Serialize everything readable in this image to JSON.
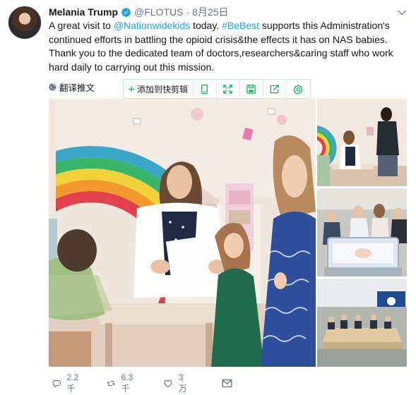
{
  "tweet": {
    "display_name": "Melania Trump",
    "handle": "@FLOTUS",
    "separator": "·",
    "date": "8月25日",
    "text_parts": {
      "p1": "A great visit to ",
      "mention": "@Nationwidekids",
      "p2": " today. ",
      "hashtag": "#BeBest",
      "p3": " supports this Administration's continued efforts in battling the opioid crisis&the effects it has on NAS babies. Thank you to the dedicated team of doctors,researchers&caring staff who work hard daily to carrying out this mission."
    },
    "translate_label": "翻译推文"
  },
  "clipper": {
    "add_label": "添加到快剪辑",
    "icons": [
      "phone-icon",
      "expand-icon",
      "save-icon",
      "share-icon",
      "settings-icon"
    ]
  },
  "actions": {
    "reply_count": "2.2千",
    "retweet_count": "6.3千",
    "like_count": "3万"
  },
  "colors": {
    "link": "#1da1f2",
    "secondary_text": "#657786",
    "clipper_green": "#1aad5c"
  }
}
